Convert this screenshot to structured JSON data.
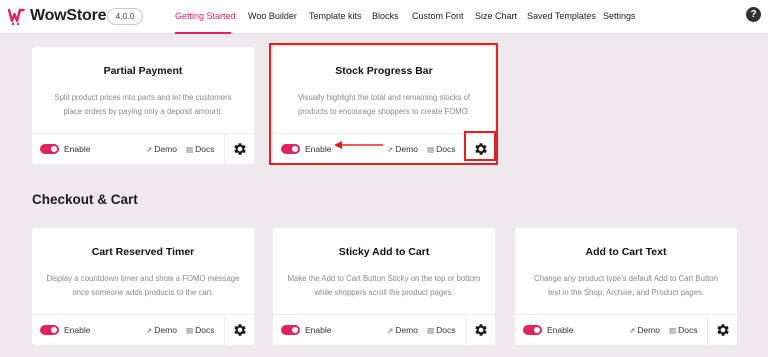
{
  "app": {
    "name": "WowStore",
    "version": "4.0.0",
    "brand_color": "#e0245e",
    "logo_icon": "wowstore-logo-icon",
    "help_label": "?"
  },
  "nav": {
    "tabs": [
      {
        "label": "Getting Started",
        "active": true
      },
      {
        "label": "Woo Builder",
        "active": false
      },
      {
        "label": "Template kits",
        "active": false
      },
      {
        "label": "Blocks",
        "active": false
      },
      {
        "label": "Custom Font",
        "active": false
      },
      {
        "label": "Size Chart",
        "active": false
      },
      {
        "label": "Saved Templates",
        "active": false
      },
      {
        "label": "Settings",
        "active": false
      }
    ]
  },
  "section": {
    "checkout_title": "Checkout & Cart"
  },
  "card_common": {
    "enable_label": "Enable",
    "demo_label": "Demo",
    "docs_label": "Docs",
    "enabled": true
  },
  "cards": [
    {
      "title": "Partial Payment",
      "description": "Split product prices into parts and let the customers place orders by paying only a deposit amount."
    },
    {
      "title": "Stock Progress Bar",
      "description": "Visually highlight the total and remaining stocks of products to encourage shoppers to create FOMO."
    },
    {
      "title": "Cart Reserved Timer",
      "description": "Display a countdown timer and show a FOMO message once someone adds products to the cart."
    },
    {
      "title": "Sticky Add to Cart",
      "description": "Make the Add to Cart Button Sticky on the top or bottom while shoppers scroll the product pages."
    },
    {
      "title": "Add to Cart Text",
      "description": "Change any product type's default Add to Cart Button text in the Shop, Archive, and Product pages."
    }
  ],
  "annotation": {
    "highlight_color": "#e32020"
  }
}
